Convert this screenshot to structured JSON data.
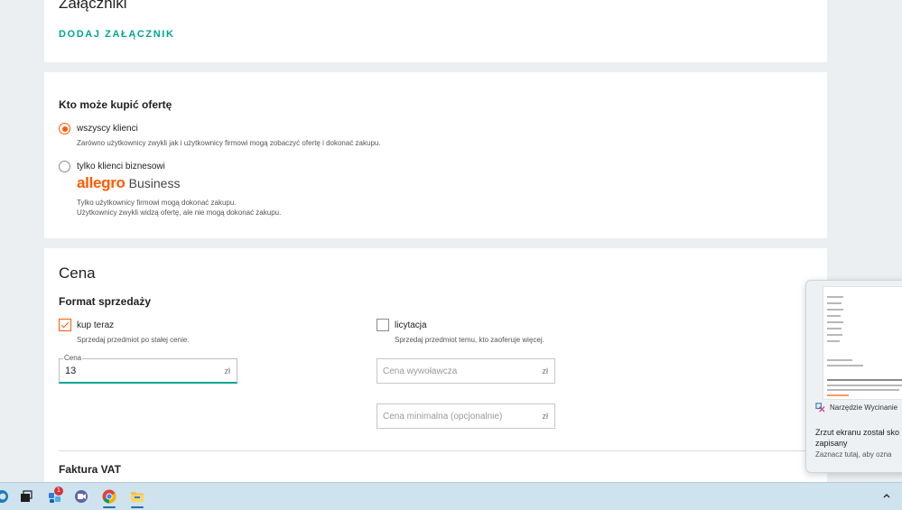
{
  "attachments": {
    "title": "Załączniki",
    "add_link": "DODAJ ZAŁĄCZNIK"
  },
  "buyers": {
    "heading": "Kto może kupić ofertę",
    "options": [
      {
        "label": "wszyscy klienci",
        "desc": "Zarówno użytkownicy zwykli jak i użytkownicy firmowi mogą zobaczyć ofertę i dokonać zakupu.",
        "checked": true
      },
      {
        "label": "tylko klienci biznesowi",
        "brand": "allegro",
        "brand_suffix": "Business",
        "desc_line1": "Tylko użytkownicy firmowi mogą dokonać zakupu.",
        "desc_line2": "Użytkownicy zwykli widzą ofertę, ale nie mogą dokonać zakupu.",
        "checked": false
      }
    ]
  },
  "price": {
    "title": "Cena",
    "format_heading": "Format sprzedaży",
    "buy_now": {
      "label": "kup teraz",
      "desc": "Sprzedaj przedmiot po stałej cenie.",
      "checked": true
    },
    "auction": {
      "label": "licytacja",
      "desc": "Sprzedaj przedmiot temu, kto zaoferuje więcej.",
      "checked": false
    },
    "price_field": {
      "legend": "Cena",
      "value": "13",
      "unit": "zł"
    },
    "starting_price": {
      "placeholder": "Cena wywoławcza",
      "unit": "zł"
    },
    "minimum_price": {
      "placeholder": "Cena minimalna (opcjonalnie)",
      "unit": "zł"
    },
    "vat_heading": "Faktura VAT"
  },
  "notification": {
    "app_name": "Narzędzie Wycinanie",
    "title_line1": "Zrzut ekranu został sko",
    "title_line2": "zapisany",
    "subtitle": "Zaznacz tutaj, aby ozna"
  },
  "taskbar": {
    "chat_badge": "1",
    "icons": [
      "edge-icon",
      "task-view-icon",
      "widgets-icon",
      "chat-icon",
      "chrome-icon",
      "file-explorer-icon"
    ]
  },
  "colors": {
    "accent_orange": "#ff5a00",
    "link_teal": "#00a790",
    "background": "#eceff1",
    "taskbar": "#cfe3ee"
  }
}
